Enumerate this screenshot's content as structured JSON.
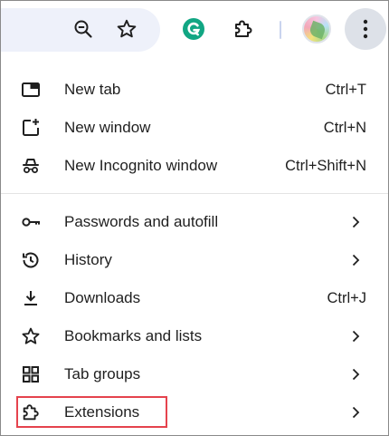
{
  "toolbar": {
    "buttons": [
      {
        "icon": "zoom-out-icon"
      },
      {
        "icon": "bookmark-star-icon"
      },
      {
        "icon": "grammarly-icon",
        "color": "#11a683"
      },
      {
        "icon": "extensions-puzzle-icon"
      }
    ],
    "avatar": {
      "icon": "profile-avatar"
    },
    "menu_button": {
      "icon": "three-dot-menu-icon"
    }
  },
  "menu": {
    "new_tab": {
      "label": "New tab",
      "shortcut": "Ctrl+T",
      "icon": "new-tab-icon"
    },
    "new_window": {
      "label": "New window",
      "shortcut": "Ctrl+N",
      "icon": "new-window-icon"
    },
    "new_incognito": {
      "label": "New Incognito window",
      "shortcut": "Ctrl+Shift+N",
      "icon": "incognito-icon"
    },
    "passwords": {
      "label": "Passwords and autofill",
      "icon": "key-icon"
    },
    "history": {
      "label": "History",
      "icon": "history-icon"
    },
    "downloads": {
      "label": "Downloads",
      "shortcut": "Ctrl+J",
      "icon": "download-icon"
    },
    "bookmarks": {
      "label": "Bookmarks and lists",
      "icon": "star-icon"
    },
    "tab_groups": {
      "label": "Tab groups",
      "icon": "tab-groups-icon"
    },
    "extensions": {
      "label": "Extensions",
      "icon": "puzzle-icon"
    }
  },
  "highlight": {
    "target": "extensions",
    "color": "#e5434d"
  }
}
